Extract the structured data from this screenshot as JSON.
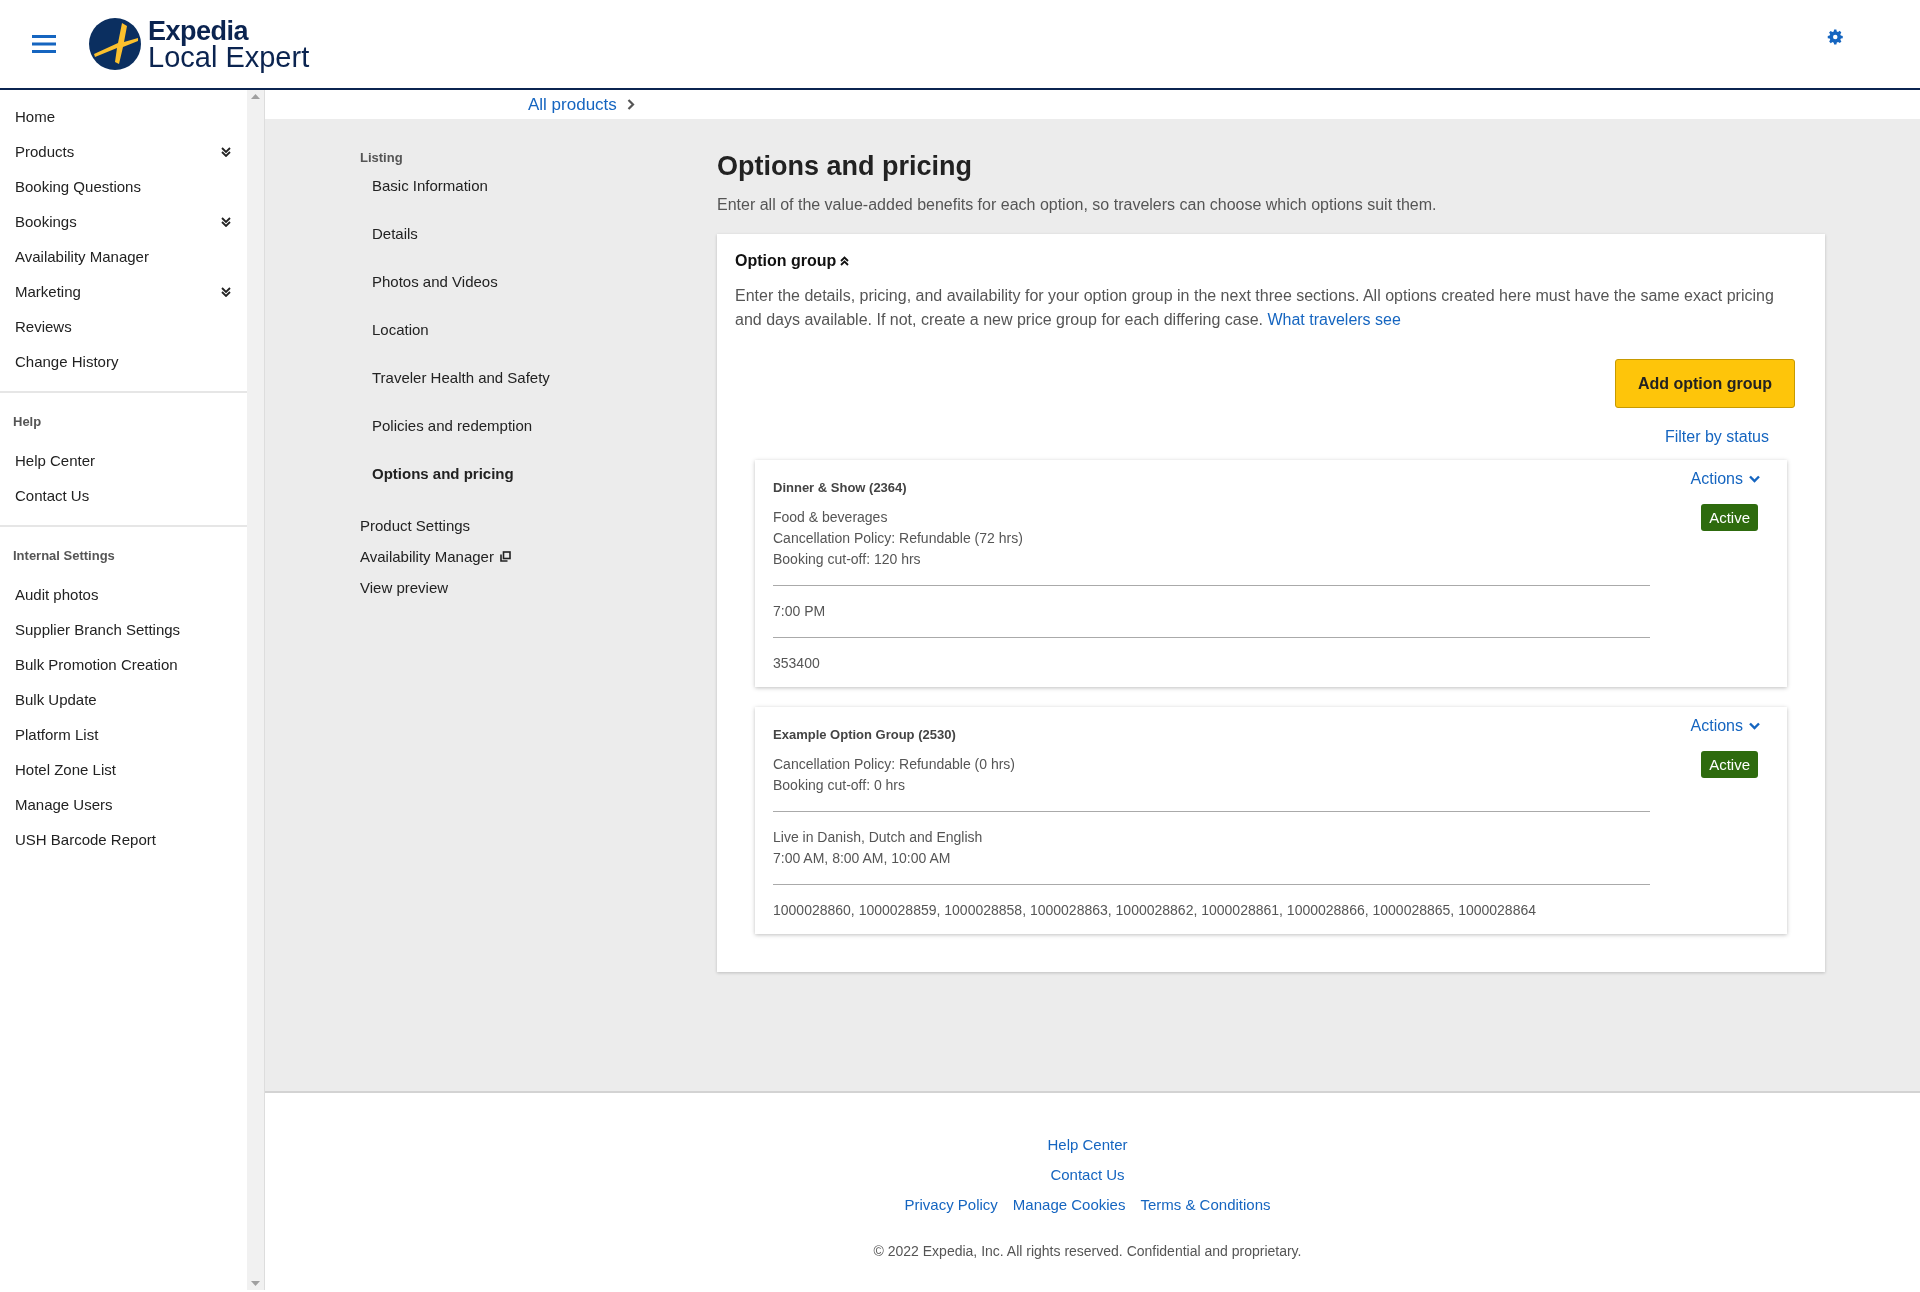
{
  "header": {
    "logo_line_1": "Expedia",
    "logo_line_2": "Local Expert"
  },
  "sidebar": {
    "sections": [
      {
        "items": [
          {
            "label": "Home",
            "kind": "link"
          },
          {
            "label": "Products",
            "kind": "menu",
            "expanded": false
          },
          {
            "label": "Booking Questions",
            "kind": "link"
          },
          {
            "label": "Bookings",
            "kind": "menu",
            "expanded": false
          },
          {
            "label": "Availability Manager",
            "kind": "link"
          },
          {
            "label": "Marketing",
            "kind": "menu",
            "expanded": false
          },
          {
            "label": "Reviews",
            "kind": "link"
          },
          {
            "label": "Change History",
            "kind": "link"
          }
        ]
      },
      {
        "heading": "Help",
        "items": [
          {
            "label": "Help Center",
            "kind": "link"
          },
          {
            "label": "Contact Us",
            "kind": "link"
          }
        ]
      },
      {
        "heading": "Internal Settings",
        "items": [
          {
            "label": "Audit photos",
            "kind": "link"
          },
          {
            "label": "Supplier Branch Settings",
            "kind": "link"
          },
          {
            "label": "Bulk Promotion Creation",
            "kind": "link"
          },
          {
            "label": "Bulk Update",
            "kind": "link"
          },
          {
            "label": "Platform List",
            "kind": "link"
          },
          {
            "label": "Hotel Zone List",
            "kind": "link"
          },
          {
            "label": "Manage Users",
            "kind": "link"
          },
          {
            "label": "USH Barcode Report",
            "kind": "link"
          }
        ]
      }
    ]
  },
  "breadcrumb": {
    "label": "All products"
  },
  "product_nav": {
    "heading": "Listing",
    "items": [
      {
        "label": "Basic Information",
        "selected": false
      },
      {
        "label": "Details",
        "selected": false
      },
      {
        "label": "Photos and Videos",
        "selected": false
      },
      {
        "label": "Location",
        "selected": false
      },
      {
        "label": "Traveler Health and Safety",
        "selected": false
      },
      {
        "label": "Policies and redemption",
        "selected": false
      },
      {
        "label": "Options and pricing",
        "selected": true
      }
    ],
    "links": [
      {
        "label": "Product Settings",
        "kind": "link"
      },
      {
        "label": "Availability Manager",
        "kind": "external"
      },
      {
        "label": "View preview",
        "kind": "link"
      }
    ]
  },
  "page": {
    "title": "Options and pricing",
    "subtitle": "Enter all of the value-added benefits for each option, so travelers can choose which options suit them."
  },
  "option_group": {
    "title": "Option group",
    "expanded": true,
    "description": "Enter the details, pricing, and availability for your option group in the next three sections. All options created here must have the same exact pricing and days available. If not, create a new price group for each differing case.",
    "link": "What travelers see",
    "add_button": "Add option group",
    "filter_link": "Filter by status",
    "groups": [
      {
        "name": "Dinner & Show (2364)",
        "actions": "Actions",
        "status": "Active",
        "sections": [
          [
            "Food & beverages",
            "Cancellation Policy: Refundable (72 hrs)",
            "Booking cut-off: 120 hrs"
          ],
          [
            "7:00 PM"
          ],
          [
            "353400"
          ]
        ]
      },
      {
        "name": "Example Option Group (2530)",
        "actions": "Actions",
        "status": "Active",
        "sections": [
          [
            "Cancellation Policy: Refundable (0 hrs)",
            "Booking cut-off: 0 hrs"
          ],
          [
            "Live in Danish, Dutch and English",
            "7:00 AM, 8:00 AM, 10:00 AM"
          ],
          [
            "1000028860, 1000028859, 1000028858, 1000028863, 1000028862, 1000028861, 1000028866, 1000028865, 1000028864"
          ]
        ]
      }
    ]
  },
  "footer": {
    "links": [
      [
        "Help Center"
      ],
      [
        "Contact Us"
      ],
      [
        "Privacy Policy",
        "Manage Cookies",
        "Terms & Conditions"
      ]
    ],
    "copyright": "© 2022 Expedia, Inc. All rights reserved. Confidential and proprietary."
  }
}
